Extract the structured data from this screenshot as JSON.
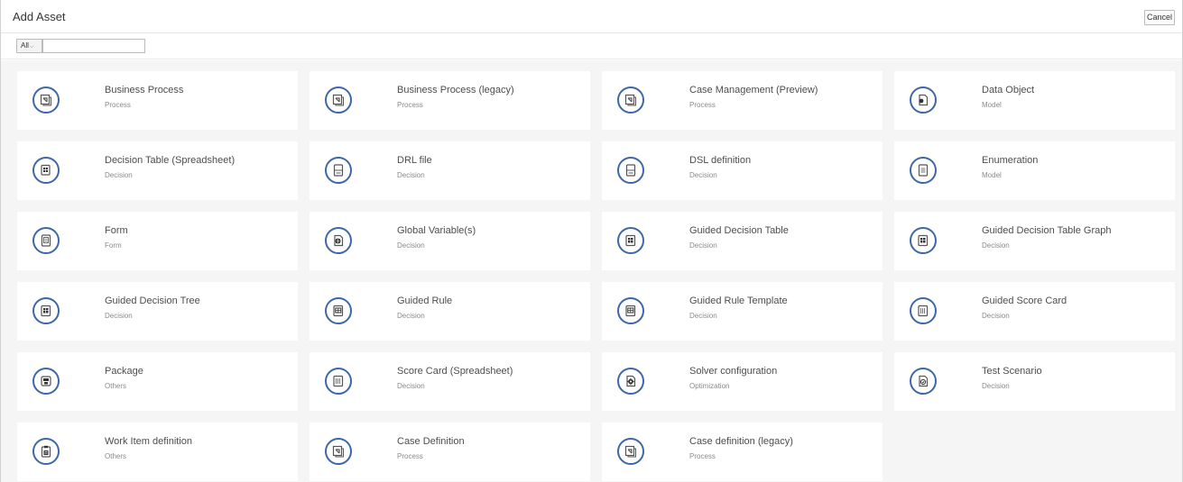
{
  "header": {
    "title": "Add Asset",
    "cancel_label": "Cancel"
  },
  "filter": {
    "selected": "All",
    "chevron": "⌵",
    "search_value": "",
    "search_placeholder": ""
  },
  "colors": {
    "icon_accent": "#3d67a8",
    "content_bg": "#f5f5f5"
  },
  "assets": [
    {
      "name": "Business Process",
      "category": "Process",
      "icon": "process-icon"
    },
    {
      "name": "Business Process (legacy)",
      "category": "Process",
      "icon": "process-icon"
    },
    {
      "name": "Case Management (Preview)",
      "category": "Process",
      "icon": "process-icon"
    },
    {
      "name": "Data Object",
      "category": "Model",
      "icon": "data-object-icon"
    },
    {
      "name": "Decision Table (Spreadsheet)",
      "category": "Decision",
      "icon": "spreadsheet-icon"
    },
    {
      "name": "DRL file",
      "category": "Decision",
      "icon": "file-icon"
    },
    {
      "name": "DSL definition",
      "category": "Decision",
      "icon": "file-icon"
    },
    {
      "name": "Enumeration",
      "category": "Model",
      "icon": "enumeration-icon"
    },
    {
      "name": "Form",
      "category": "Form",
      "icon": "form-icon"
    },
    {
      "name": "Global Variable(s)",
      "category": "Decision",
      "icon": "global-icon"
    },
    {
      "name": "Guided Decision Table",
      "category": "Decision",
      "icon": "table-icon"
    },
    {
      "name": "Guided Decision Table Graph",
      "category": "Decision",
      "icon": "table-icon"
    },
    {
      "name": "Guided Decision Tree",
      "category": "Decision",
      "icon": "table-icon"
    },
    {
      "name": "Guided Rule",
      "category": "Decision",
      "icon": "rule-icon"
    },
    {
      "name": "Guided Rule Template",
      "category": "Decision",
      "icon": "rule-icon"
    },
    {
      "name": "Guided Score Card",
      "category": "Decision",
      "icon": "scorecard-icon"
    },
    {
      "name": "Package",
      "category": "Others",
      "icon": "package-icon"
    },
    {
      "name": "Score Card (Spreadsheet)",
      "category": "Decision",
      "icon": "scorecard-icon"
    },
    {
      "name": "Solver configuration",
      "category": "Optimization",
      "icon": "gear-icon"
    },
    {
      "name": "Test Scenario",
      "category": "Decision",
      "icon": "test-icon"
    },
    {
      "name": "Work Item definition",
      "category": "Others",
      "icon": "clipboard-icon"
    },
    {
      "name": "Case Definition",
      "category": "Process",
      "icon": "process-icon"
    },
    {
      "name": "Case definition (legacy)",
      "category": "Process",
      "icon": "process-icon"
    }
  ]
}
